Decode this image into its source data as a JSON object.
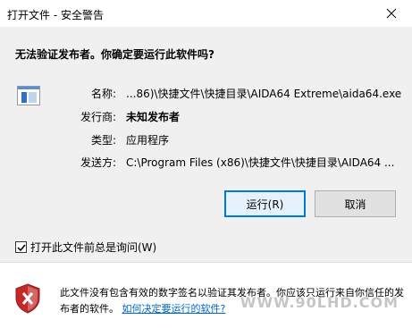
{
  "window": {
    "title": "打开文件 - 安全警告"
  },
  "dialog": {
    "question": "无法验证发布者。你确定要运行此软件吗?",
    "fields": [
      {
        "label": "名称:",
        "value": "...86)\\快捷文件\\快捷目录\\AIDA64 Extreme\\aida64.exe"
      },
      {
        "label": "发行商:",
        "value": "未知发布者"
      },
      {
        "label": "类型:",
        "value": "应用程序"
      },
      {
        "label": "发送方:",
        "value": "C:\\Program Files (x86)\\快捷文件\\快捷目录\\AIDA64 ..."
      }
    ],
    "run_button": "运行(R)",
    "cancel_button": "取消",
    "checkbox_label": "打开此文件前总是询问(W)",
    "checkbox_checked": true
  },
  "footer": {
    "warning_text": "此文件没有包含有效的数字签名以验证其发布者。你应该只运行来自你信任的发布者的软件。",
    "link_text": "如何决定要运行的软件?",
    "watermark": "WWW.90LHD.COM"
  },
  "colors": {
    "accent": "#0078d7",
    "link": "#0066cc",
    "shield_red": "#c62828"
  },
  "icons": {
    "close": "close-icon",
    "app": "application-icon",
    "warning": "shield-warning-icon",
    "check": "checkmark-icon"
  }
}
